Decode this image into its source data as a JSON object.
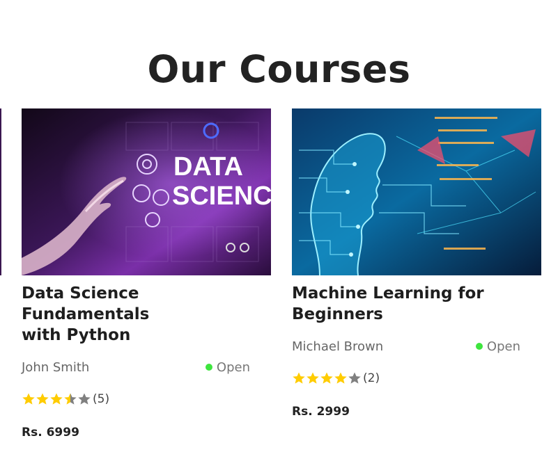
{
  "page": {
    "title": "Our Courses"
  },
  "colors": {
    "star_filled": "#ffcc00",
    "star_empty": "#808080",
    "open_dot": "#3ee53e"
  },
  "courses": [
    {
      "title_line1": "Data Science Fundamentals",
      "title_line2": "with Python",
      "instructor": "John Smith",
      "status": "Open",
      "rating": 3.5,
      "rating_count": "(5)",
      "price": "Rs. 6999",
      "image_text_line1": "DATA",
      "image_text_line2": "SCIENCE"
    },
    {
      "title_line1": "Machine Learning for",
      "title_line2": "Beginners",
      "instructor": "Michael Brown",
      "status": "Open",
      "rating": 4,
      "rating_count": "(2)",
      "price": "Rs. 2999"
    }
  ]
}
